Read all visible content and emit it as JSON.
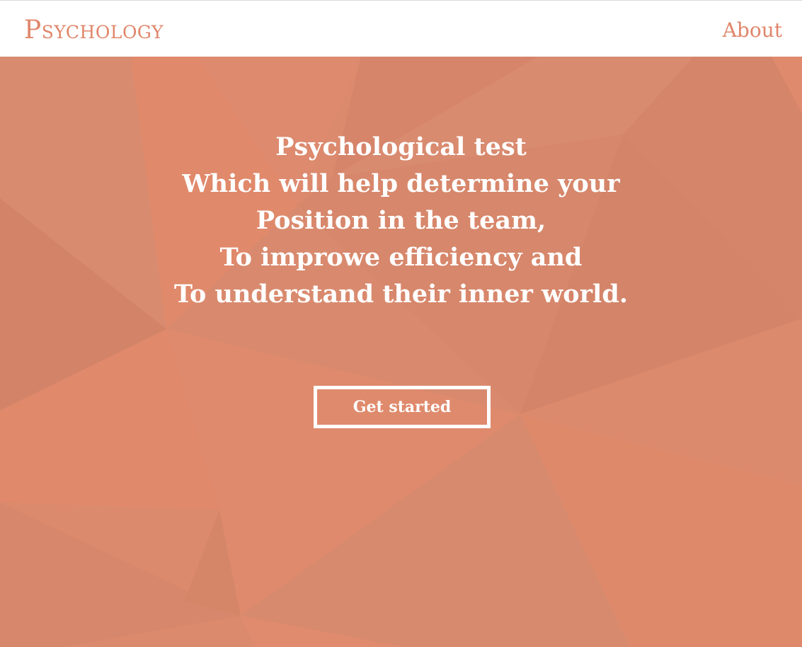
{
  "header": {
    "logo_text": "Psychology",
    "nav_about_label": "About"
  },
  "hero": {
    "headline_lines": [
      "Psychological test",
      "Which will help determine your",
      "Position in the team,",
      "To improwe efficiency and",
      "To understand their inner world."
    ],
    "cta_label": "Get started"
  },
  "colors": {
    "accent": "#e0866a",
    "hero_base": "#dc8a6e",
    "text_on_hero": "#ffffff",
    "header_bg": "#ffffff"
  }
}
